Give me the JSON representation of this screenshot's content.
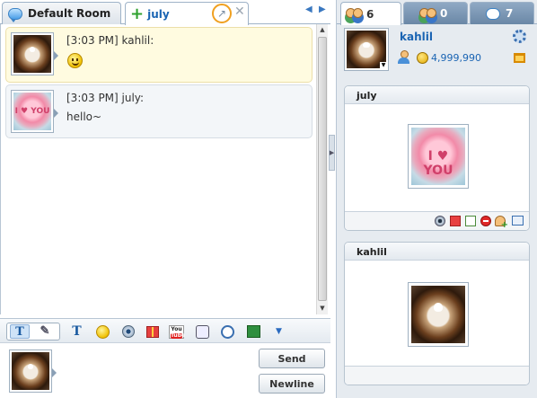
{
  "tabs": [
    {
      "label": "Default Room",
      "icon": "speech-bubble-icon"
    },
    {
      "label": "july",
      "icon": "plus-icon"
    }
  ],
  "tab_controls": {
    "popout_glyph": "↗",
    "close_glyph": "✕",
    "prev_glyph": "◀",
    "next_glyph": "▶"
  },
  "messages": [
    {
      "header": "[3:03 PM] kahlil:",
      "body_emoticon": "smiley-emoticon",
      "avatar": "coffee-latte-art"
    },
    {
      "header": "[3:03 PM] july:",
      "body": "hello~",
      "avatar": "candy-heart-i-love-you",
      "avatar_text": "I ♥ YOU"
    }
  ],
  "toolbar": {
    "items": [
      "text-mode-icon",
      "handwrite-mode-icon",
      "font-format-icon",
      "emoticon-icon",
      "webcam-icon",
      "gift-icon",
      "youtube-icon",
      "whiteboard-icon",
      "voice-call-icon",
      "screen-share-icon",
      "more-icon"
    ],
    "text_glyph": "T",
    "pencil_glyph": "✎",
    "youtube_top": "You",
    "youtube_bottom": "Tube",
    "more_glyph": "▼"
  },
  "input": {
    "send_label": "Send",
    "newline_label": "Newline"
  },
  "right_tabs": [
    {
      "icon": "users-icon",
      "count": "6",
      "active": true
    },
    {
      "icon": "friends-icon",
      "count": "0",
      "active": false
    },
    {
      "icon": "messages-icon",
      "count": "7",
      "active": false
    }
  ],
  "profile": {
    "name": "kahlil",
    "coins": "4,999,990",
    "caret": "▼"
  },
  "video_panels": [
    {
      "name": "july",
      "avatar": "candy-heart-i-love-you",
      "avatar_text": "I ♥ YOU"
    },
    {
      "name": "kahlil",
      "avatar": "coffee-latte-art"
    }
  ],
  "colors": {
    "accent": "#1a64b3",
    "highlight_ring": "#f0a020",
    "message_highlight": "#fffbe0",
    "panel_bg": "#e6ebf0"
  }
}
